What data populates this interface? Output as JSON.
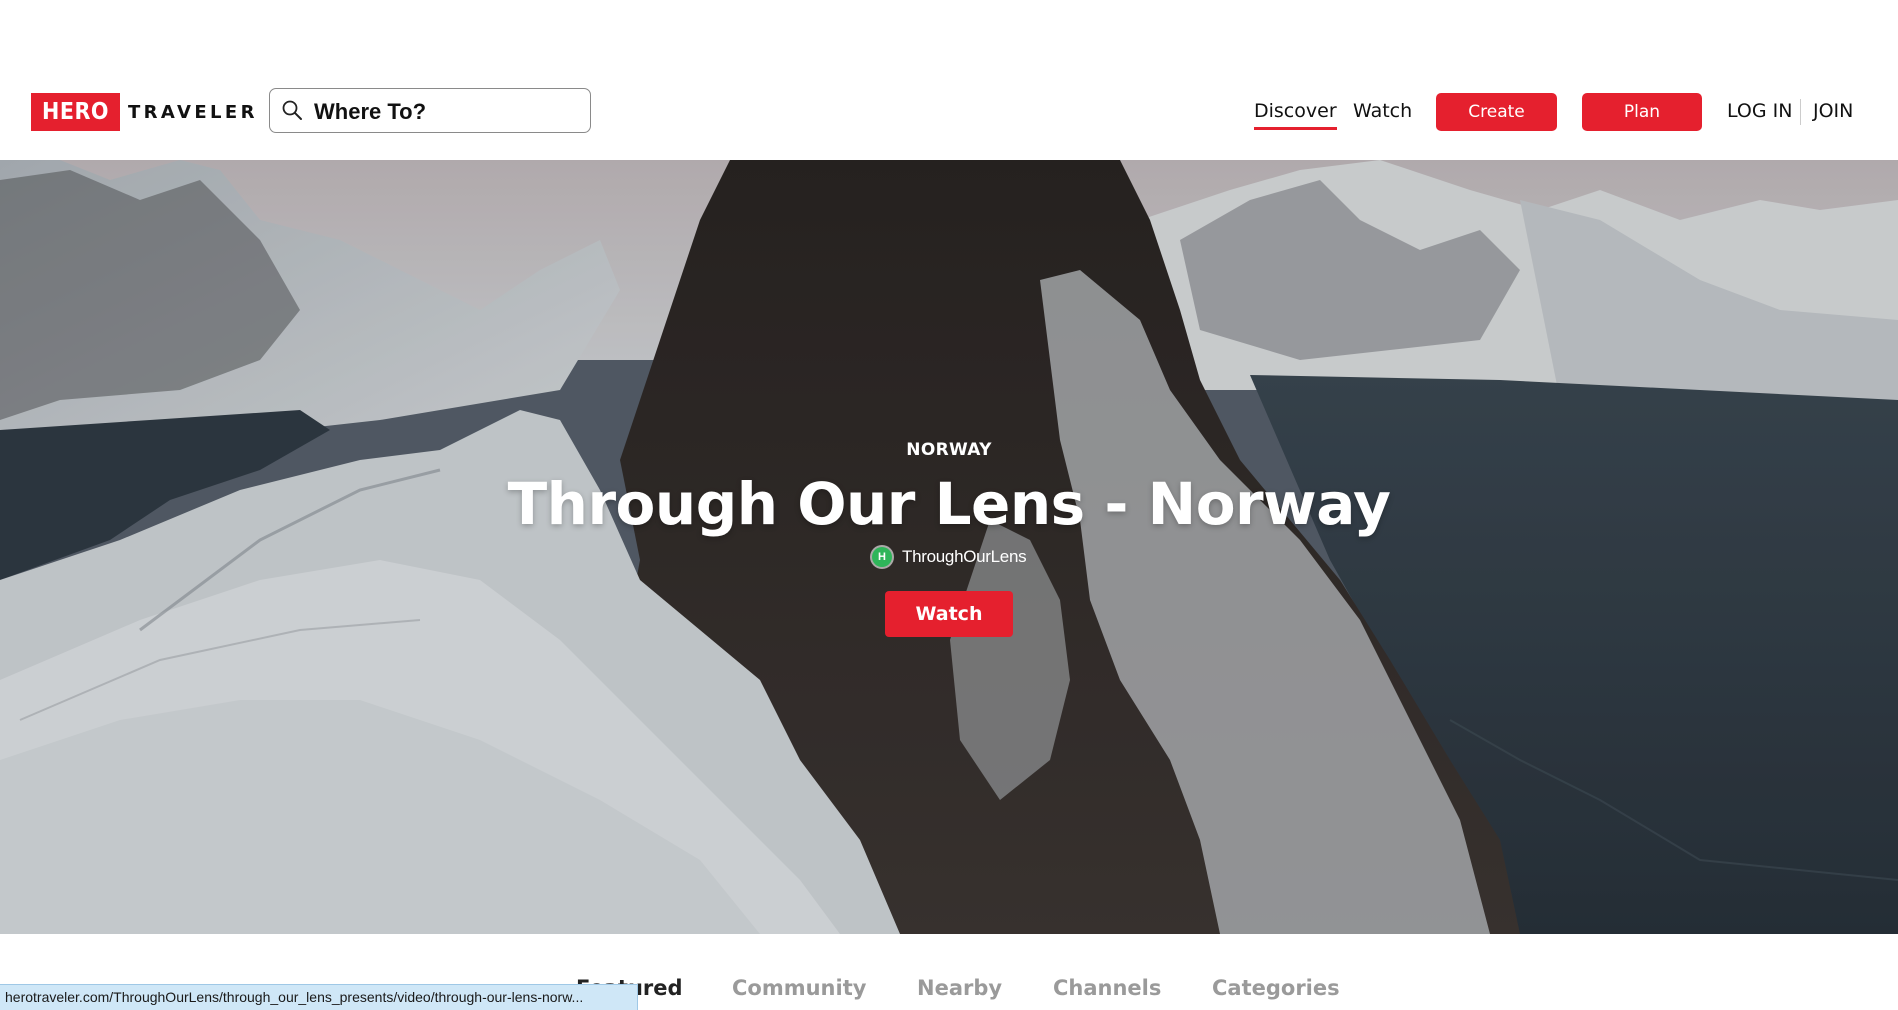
{
  "header": {
    "logo_badge": "HERO",
    "logo_text": "TRAVELER",
    "search": {
      "placeholder": "Where To?",
      "icon": "search-icon"
    },
    "nav": {
      "discover": "Discover",
      "watch": "Watch",
      "create": "Create",
      "plan": "Plan",
      "login": "LOG IN",
      "join": "JOIN"
    }
  },
  "hero": {
    "country": "NORWAY",
    "title": "Through Our Lens - Norway",
    "author": {
      "initial": "H",
      "name": "ThroughOurLens"
    },
    "watch_label": "Watch"
  },
  "tabs": [
    {
      "label": "Featured",
      "active": true
    },
    {
      "label": "Community",
      "active": false
    },
    {
      "label": "Nearby",
      "active": false
    },
    {
      "label": "Channels",
      "active": false
    },
    {
      "label": "Categories",
      "active": false
    }
  ],
  "status_bar": {
    "url": "herotraveler.com/ThroughOurLens/through_our_lens_presents/video/through-our-lens-norw..."
  },
  "colors": {
    "brand_red": "#e5202e",
    "text_dark": "#111111",
    "tab_inactive": "#9a9a9a"
  }
}
